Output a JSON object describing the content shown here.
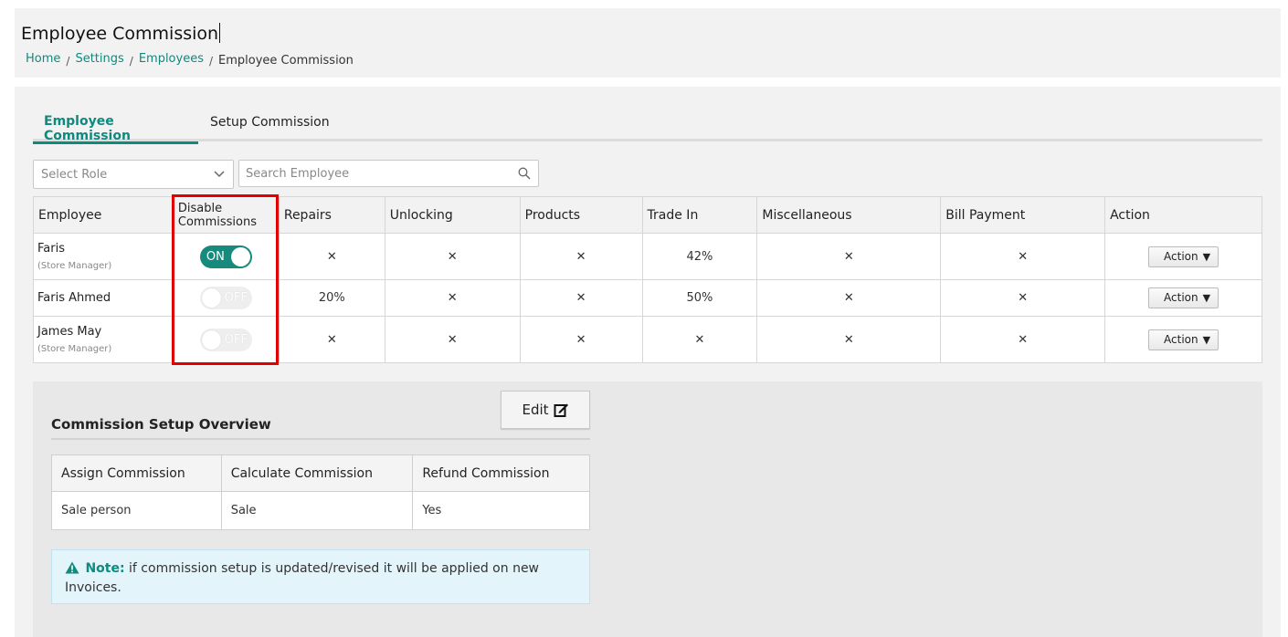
{
  "header": {
    "title": "Employee Commission",
    "breadcrumb": {
      "home": "Home",
      "settings": "Settings",
      "employees": "Employees",
      "current": "Employee Commission",
      "separator": "/"
    }
  },
  "tabs": {
    "active": "Employee Commission",
    "inactive": "Setup Commission"
  },
  "filters": {
    "select_role_placeholder": "Select Role",
    "search_placeholder": "Search Employee"
  },
  "table": {
    "headers": {
      "employee": "Employee",
      "disable_commissions": "Disable Commissions",
      "repairs": "Repairs",
      "unlocking": "Unlocking",
      "products": "Products",
      "trade_in": "Trade In",
      "miscellaneous": "Miscellaneous",
      "bill_payment": "Bill Payment",
      "action": "Action"
    },
    "rows": [
      {
        "name": "Faris",
        "role": "(Store Manager)",
        "toggle": "ON",
        "repairs": "✕",
        "unlocking": "✕",
        "products": "✕",
        "trade_in": "42%",
        "miscellaneous": "✕",
        "bill_payment": "✕",
        "action": "Action"
      },
      {
        "name": "Faris Ahmed",
        "role": "",
        "toggle": "OFF",
        "repairs": "20%",
        "unlocking": "✕",
        "products": "✕",
        "trade_in": "50%",
        "miscellaneous": "✕",
        "bill_payment": "✕",
        "action": "Action"
      },
      {
        "name": "James May",
        "role": "(Store Manager)",
        "toggle": "OFF",
        "repairs": "✕",
        "unlocking": "✕",
        "products": "✕",
        "trade_in": "✕",
        "miscellaneous": "✕",
        "bill_payment": "✕",
        "action": "Action"
      }
    ],
    "action_caret": "▼"
  },
  "overview": {
    "title": "Commission Setup Overview",
    "edit_label": "Edit",
    "headers": {
      "assign": "Assign Commission",
      "calculate": "Calculate Commission",
      "refund": "Refund Commission"
    },
    "values": {
      "assign": "Sale person",
      "calculate": "Sale",
      "refund": "Yes"
    },
    "note_label": "Note:",
    "note_text": "if commission setup is updated/revised it will be applied on new Invoices."
  },
  "colors": {
    "accent": "#0e8a7e",
    "highlight": "#e00000",
    "note_bg": "#e3f4fb"
  },
  "icons": {
    "select_chevron": "chevron-down-icon",
    "search": "search-icon",
    "edit": "edit-icon",
    "note": "warning-icon"
  }
}
